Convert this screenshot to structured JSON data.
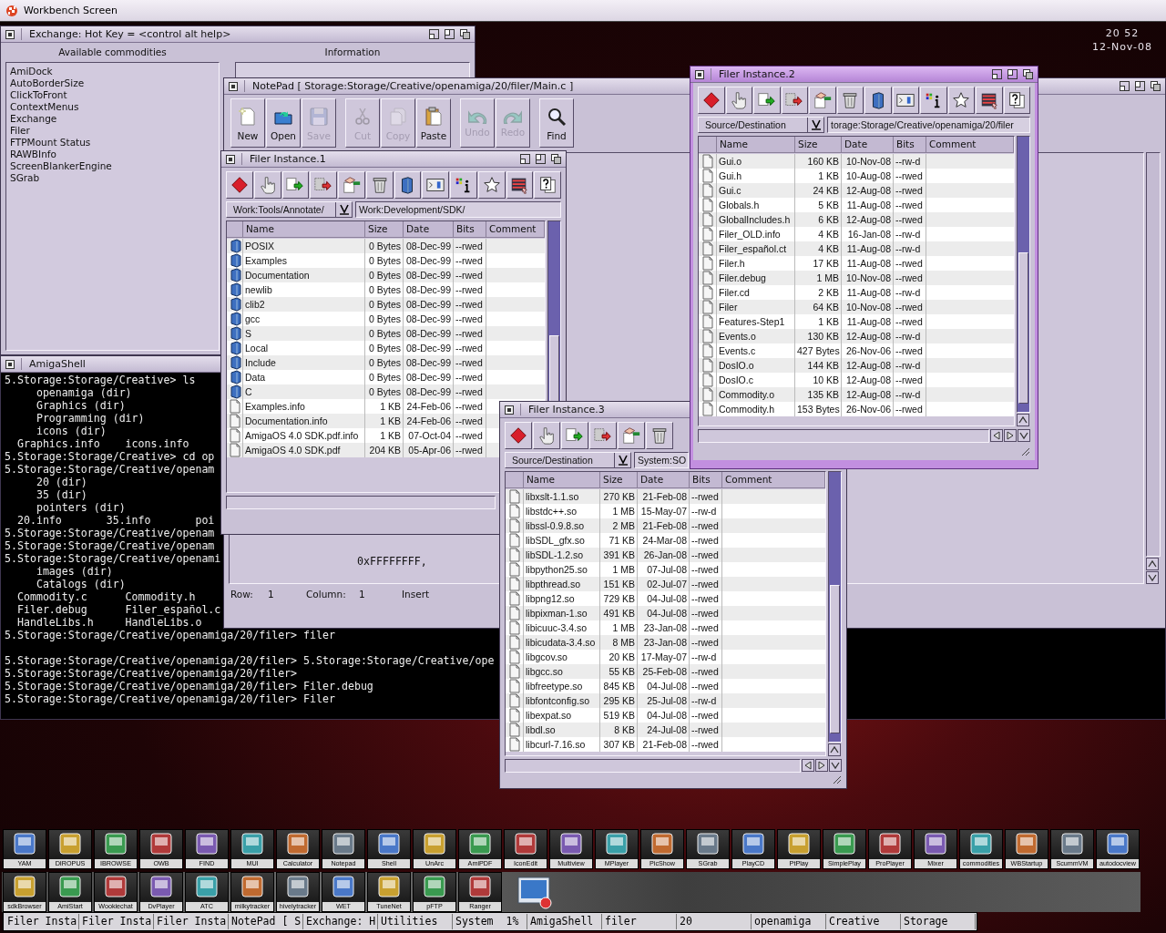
{
  "screen": {
    "title": "Workbench Screen"
  },
  "clock": {
    "time": "20 52",
    "date": "12-Nov-08"
  },
  "exchange": {
    "title": "Exchange: Hot Key = <control alt help>",
    "active": false,
    "list_heading": "Available commodities",
    "info_heading": "Information",
    "commodities": [
      "AmiDock",
      "AutoBorderSize",
      "ClickToFront",
      "ContextMenus",
      "Exchange",
      "Filer",
      "FTPMount Status",
      "RAWBInfo",
      "ScreenBlankerEngine",
      "SGrab"
    ]
  },
  "shell": {
    "title": "AmigaShell",
    "active": false,
    "blocks": [
      [
        "5.Storage:Storage/Creative> ls",
        "     openamiga (dir)",
        "     Graphics (dir)",
        "     Programming (dir)",
        "     icons (dir)",
        "  Graphics.info    icons.info",
        "5.Storage:Storage/Creative> cd op",
        "5.Storage:Storage/Creative/openam",
        "     20 (dir)",
        "     35 (dir)",
        "     pointers (dir)",
        "  20.info       35.info       poi",
        "5.Storage:Storage/Creative/openam",
        "5.Storage:Storage/Creative/openam",
        "5.Storage:Storage/Creative/openami",
        "     images (dir)",
        "     Catalogs (dir)",
        "  Commodity.c      Commodity.h",
        "  Filer.debug      Filer_español.c",
        "  HandleLibs.h     HandleLibs.o",
        "5.Storage:Storage/Creative/openamiga/20/filer> filer"
      ],
      [
        "5.Storage:Storage/Creative/openamiga/20/filer> 5.Storage:Storage/Creative/ope",
        "5.Storage:Storage/Creative/openamiga/20/filer>",
        "5.Storage:Storage/Creative/openamiga/20/filer> Filer.debug",
        "5.Storage:Storage/Creative/openamiga/20/filer> Filer"
      ]
    ]
  },
  "notepad": {
    "title": "NotePad [ Storage:Storage/Creative/openamiga/20/filer/Main.c ]",
    "active": false,
    "toolbar": [
      [
        {
          "kind": "new",
          "label": "New",
          "disabled": false
        },
        {
          "kind": "open",
          "label": "Open",
          "disabled": false
        },
        {
          "kind": "save",
          "label": "Save",
          "disabled": true
        }
      ],
      [
        {
          "kind": "cut",
          "label": "Cut",
          "disabled": true
        },
        {
          "kind": "copy",
          "label": "Copy",
          "disabled": true
        },
        {
          "kind": "paste",
          "label": "Paste",
          "disabled": false
        }
      ],
      [
        {
          "kind": "undo",
          "label": "Undo",
          "disabled": true
        },
        {
          "kind": "redo",
          "label": "Redo",
          "disabled": true
        }
      ],
      [
        {
          "kind": "find",
          "label": "Find",
          "disabled": false
        }
      ]
    ],
    "text": [
      "0xFFFFFFFF,"
    ],
    "status": {
      "row_label": "Row:",
      "row": "1",
      "column_label": "Column:",
      "column": "1",
      "mode": "Insert"
    }
  },
  "filers": [
    {
      "title": "Filer Instance.1",
      "active": false,
      "toolbar": [
        {
          "kind": "diamond"
        },
        {
          "kind": "hand"
        },
        {
          "kind": "copy"
        },
        {
          "kind": "move"
        },
        {
          "kind": "rename"
        },
        {
          "kind": "trash"
        },
        {
          "kind": "cube"
        },
        {
          "kind": "shell"
        },
        {
          "kind": "info"
        },
        {
          "kind": "star"
        },
        {
          "kind": "list"
        },
        {
          "kind": "help"
        }
      ],
      "source": "Work:Tools/Annotate/",
      "path": "Work:Development/SDK/",
      "columns": [
        "Name",
        "Size",
        "Date",
        "Bits",
        "Comment"
      ],
      "rows": [
        {
          "kind": "drawer",
          "name": "POSIX",
          "size": "0 Bytes",
          "date": "08-Dec-99",
          "bits": "--rwed"
        },
        {
          "kind": "drawer",
          "name": "Examples",
          "size": "0 Bytes",
          "date": "08-Dec-99",
          "bits": "--rwed"
        },
        {
          "kind": "drawer",
          "name": "Documentation",
          "size": "0 Bytes",
          "date": "08-Dec-99",
          "bits": "--rwed"
        },
        {
          "kind": "drawer",
          "name": "newlib",
          "size": "0 Bytes",
          "date": "08-Dec-99",
          "bits": "--rwed"
        },
        {
          "kind": "drawer",
          "name": "clib2",
          "size": "0 Bytes",
          "date": "08-Dec-99",
          "bits": "--rwed"
        },
        {
          "kind": "drawer",
          "name": "gcc",
          "size": "0 Bytes",
          "date": "08-Dec-99",
          "bits": "--rwed"
        },
        {
          "kind": "drawer",
          "name": "S",
          "size": "0 Bytes",
          "date": "08-Dec-99",
          "bits": "--rwed"
        },
        {
          "kind": "drawer",
          "name": "Local",
          "size": "0 Bytes",
          "date": "08-Dec-99",
          "bits": "--rwed"
        },
        {
          "kind": "drawer",
          "name": "Include",
          "size": "0 Bytes",
          "date": "08-Dec-99",
          "bits": "--rwed"
        },
        {
          "kind": "drawer",
          "name": "Data",
          "size": "0 Bytes",
          "date": "08-Dec-99",
          "bits": "--rwed"
        },
        {
          "kind": "drawer",
          "name": "C",
          "size": "0 Bytes",
          "date": "08-Dec-99",
          "bits": "--rwed"
        },
        {
          "kind": "file",
          "name": "Examples.info",
          "size": "1 KB",
          "date": "24-Feb-06",
          "bits": "--rwed"
        },
        {
          "kind": "file",
          "name": "Documentation.info",
          "size": "1 KB",
          "date": "24-Feb-06",
          "bits": "--rwed"
        },
        {
          "kind": "file",
          "name": "AmigaOS 4.0 SDK.pdf.info",
          "size": "1 KB",
          "date": "07-Oct-04",
          "bits": "--rwed"
        },
        {
          "kind": "file",
          "name": "AmigaOS 4.0 SDK.pdf",
          "size": "204 KB",
          "date": "05-Apr-06",
          "bits": "--rwed"
        }
      ]
    },
    {
      "title": "Filer Instance.2",
      "active": true,
      "toolbar": [
        {
          "kind": "diamond"
        },
        {
          "kind": "hand"
        },
        {
          "kind": "copy"
        },
        {
          "kind": "move"
        },
        {
          "kind": "rename"
        },
        {
          "kind": "trash"
        },
        {
          "kind": "cube"
        },
        {
          "kind": "shell"
        },
        {
          "kind": "info"
        },
        {
          "kind": "star"
        },
        {
          "kind": "list"
        },
        {
          "kind": "help"
        }
      ],
      "source": "Source/Destination",
      "path": "torage:Storage/Creative/openamiga/20/filer",
      "columns": [
        "Name",
        "Size",
        "Date",
        "Bits",
        "Comment"
      ],
      "rows": [
        {
          "kind": "file",
          "name": "Gui.o",
          "size": "160 KB",
          "date": "10-Nov-08",
          "bits": "--rw-d"
        },
        {
          "kind": "file",
          "name": "Gui.h",
          "size": "1 KB",
          "date": "10-Aug-08",
          "bits": "--rwed"
        },
        {
          "kind": "file",
          "name": "Gui.c",
          "size": "24 KB",
          "date": "12-Aug-08",
          "bits": "--rwed"
        },
        {
          "kind": "file",
          "name": "Globals.h",
          "size": "5 KB",
          "date": "11-Aug-08",
          "bits": "--rwed"
        },
        {
          "kind": "file",
          "name": "GlobalIncludes.h",
          "size": "6 KB",
          "date": "12-Aug-08",
          "bits": "--rwed"
        },
        {
          "kind": "file",
          "name": "Filer_OLD.info",
          "size": "4 KB",
          "date": "16-Jan-08",
          "bits": "--rw-d"
        },
        {
          "kind": "file",
          "name": "Filer_español.ct",
          "size": "4 KB",
          "date": "11-Aug-08",
          "bits": "--rw-d"
        },
        {
          "kind": "file",
          "name": "Filer.h",
          "size": "17 KB",
          "date": "11-Aug-08",
          "bits": "--rwed"
        },
        {
          "kind": "file",
          "name": "Filer.debug",
          "size": "1 MB",
          "date": "10-Nov-08",
          "bits": "--rwed"
        },
        {
          "kind": "file",
          "name": "Filer.cd",
          "size": "2 KB",
          "date": "11-Aug-08",
          "bits": "--rw-d"
        },
        {
          "kind": "file",
          "name": "Filer",
          "size": "64 KB",
          "date": "10-Nov-08",
          "bits": "--rwed"
        },
        {
          "kind": "file",
          "name": "Features-Step1",
          "size": "1 KB",
          "date": "11-Aug-08",
          "bits": "--rwed"
        },
        {
          "kind": "file",
          "name": "Events.o",
          "size": "130 KB",
          "date": "12-Aug-08",
          "bits": "--rw-d"
        },
        {
          "kind": "file",
          "name": "Events.c",
          "size": "427 Bytes",
          "date": "26-Nov-06",
          "bits": "--rwed"
        },
        {
          "kind": "file",
          "name": "DosIO.o",
          "size": "144 KB",
          "date": "12-Aug-08",
          "bits": "--rw-d"
        },
        {
          "kind": "file",
          "name": "DosIO.c",
          "size": "10 KB",
          "date": "12-Aug-08",
          "bits": "--rwed"
        },
        {
          "kind": "file",
          "name": "Commodity.o",
          "size": "135 KB",
          "date": "12-Aug-08",
          "bits": "--rw-d"
        },
        {
          "kind": "file",
          "name": "Commodity.h",
          "size": "153 Bytes",
          "date": "26-Nov-06",
          "bits": "--rwed"
        }
      ]
    },
    {
      "title": "Filer Instance.3",
      "active": false,
      "toolbar": [
        {
          "kind": "diamond"
        },
        {
          "kind": "hand"
        },
        {
          "kind": "copy"
        },
        {
          "kind": "move"
        },
        {
          "kind": "rename"
        },
        {
          "kind": "trash"
        }
      ],
      "source": "Source/Destination",
      "path": "System:SO",
      "columns": [
        "Name",
        "Size",
        "Date",
        "Bits",
        "Comment"
      ],
      "rows": [
        {
          "kind": "file",
          "name": "libxslt-1.1.so",
          "size": "270 KB",
          "date": "21-Feb-08",
          "bits": "--rwed"
        },
        {
          "kind": "file",
          "name": "libstdc++.so",
          "size": "1 MB",
          "date": "15-May-07",
          "bits": "--rw-d"
        },
        {
          "kind": "file",
          "name": "libssl-0.9.8.so",
          "size": "2 MB",
          "date": "21-Feb-08",
          "bits": "--rwed"
        },
        {
          "kind": "file",
          "name": "libSDL_gfx.so",
          "size": "71 KB",
          "date": "24-Mar-08",
          "bits": "--rwed"
        },
        {
          "kind": "file",
          "name": "libSDL-1.2.so",
          "size": "391 KB",
          "date": "26-Jan-08",
          "bits": "--rwed"
        },
        {
          "kind": "file",
          "name": "libpython25.so",
          "size": "1 MB",
          "date": "07-Jul-08",
          "bits": "--rwed"
        },
        {
          "kind": "file",
          "name": "libpthread.so",
          "size": "151 KB",
          "date": "02-Jul-07",
          "bits": "--rwed"
        },
        {
          "kind": "file",
          "name": "libpng12.so",
          "size": "729 KB",
          "date": "04-Jul-08",
          "bits": "--rwed"
        },
        {
          "kind": "file",
          "name": "libpixman-1.so",
          "size": "491 KB",
          "date": "04-Jul-08",
          "bits": "--rwed"
        },
        {
          "kind": "file",
          "name": "libicuuc-3.4.so",
          "size": "1 MB",
          "date": "23-Jan-08",
          "bits": "--rwed"
        },
        {
          "kind": "file",
          "name": "libicudata-3.4.so",
          "size": "8 MB",
          "date": "23-Jan-08",
          "bits": "--rwed"
        },
        {
          "kind": "file",
          "name": "libgcov.so",
          "size": "20 KB",
          "date": "17-May-07",
          "bits": "--rw-d"
        },
        {
          "kind": "file",
          "name": "libgcc.so",
          "size": "55 KB",
          "date": "25-Feb-08",
          "bits": "--rwed"
        },
        {
          "kind": "file",
          "name": "libfreetype.so",
          "size": "845 KB",
          "date": "04-Jul-08",
          "bits": "--rwed"
        },
        {
          "kind": "file",
          "name": "libfontconfig.so",
          "size": "295 KB",
          "date": "25-Jul-08",
          "bits": "--rw-d"
        },
        {
          "kind": "file",
          "name": "libexpat.so",
          "size": "519 KB",
          "date": "04-Jul-08",
          "bits": "--rwed"
        },
        {
          "kind": "file",
          "name": "libdl.so",
          "size": "8 KB",
          "date": "24-Jul-08",
          "bits": "--rwed"
        },
        {
          "kind": "file",
          "name": "libcurl-7.16.so",
          "size": "307 KB",
          "date": "21-Feb-08",
          "bits": "--rwed"
        }
      ]
    }
  ],
  "dock": {
    "rows": [
      [
        {
          "kind": "app",
          "label": "YAM"
        },
        {
          "kind": "app",
          "label": "DIROPUS"
        },
        {
          "kind": "app",
          "label": "IBROWSE"
        },
        {
          "kind": "app",
          "label": "OWB"
        },
        {
          "kind": "app",
          "label": "FIND"
        },
        {
          "kind": "app",
          "label": "MUI"
        },
        {
          "kind": "app",
          "label": "Calculator"
        },
        {
          "kind": "app",
          "label": "Notepad"
        },
        {
          "kind": "app",
          "label": "Shell"
        },
        {
          "kind": "app",
          "label": "UnArc"
        },
        {
          "kind": "app",
          "label": "AmiPDF"
        },
        {
          "kind": "app",
          "label": "IconEdit"
        },
        {
          "kind": "app",
          "label": "Multiview"
        },
        {
          "kind": "app",
          "label": "MPlayer"
        },
        {
          "kind": "app",
          "label": "PicShow"
        },
        {
          "kind": "app",
          "label": "SGrab"
        },
        {
          "kind": "app",
          "label": "PlayCD"
        },
        {
          "kind": "app",
          "label": "PtPlay"
        },
        {
          "kind": "app",
          "label": "SimplePlay"
        },
        {
          "kind": "app",
          "label": "ProPlayer"
        },
        {
          "kind": "app",
          "label": "Mixer"
        },
        {
          "kind": "app",
          "label": "commodities"
        },
        {
          "kind": "app",
          "label": "WBStartup"
        },
        {
          "kind": "app",
          "label": "ScummVM"
        },
        {
          "kind": "app",
          "label": "autodocview"
        }
      ],
      [
        {
          "kind": "app",
          "label": "sdkBrowser"
        },
        {
          "kind": "app",
          "label": "AmiStart"
        },
        {
          "kind": "app",
          "label": "Wookiechat"
        },
        {
          "kind": "app",
          "label": "DvPlayer"
        },
        {
          "kind": "app",
          "label": "ATC"
        },
        {
          "kind": "app",
          "label": "milkytracker"
        },
        {
          "kind": "app",
          "label": "hivelytracker"
        },
        {
          "kind": "app",
          "label": "WET"
        },
        {
          "kind": "app",
          "label": "TuneNet"
        },
        {
          "kind": "app",
          "label": "pFTP"
        },
        {
          "kind": "app",
          "label": "Ranger"
        },
        {
          "kind": "picture"
        }
      ]
    ]
  },
  "taskbar": [
    {
      "label": "Filer Insta"
    },
    {
      "label": "Filer Insta"
    },
    {
      "label": "Filer Insta"
    },
    {
      "label": "NotePad [ S"
    },
    {
      "label": "Exchange: H"
    },
    {
      "label": "Utilities"
    },
    {
      "label": "System",
      "reading": "1%"
    },
    {
      "label": "AmigaShell"
    },
    {
      "label": "filer"
    },
    {
      "label": "20"
    },
    {
      "label": "openamiga"
    },
    {
      "label": "Creative"
    },
    {
      "label": "Storage"
    }
  ]
}
